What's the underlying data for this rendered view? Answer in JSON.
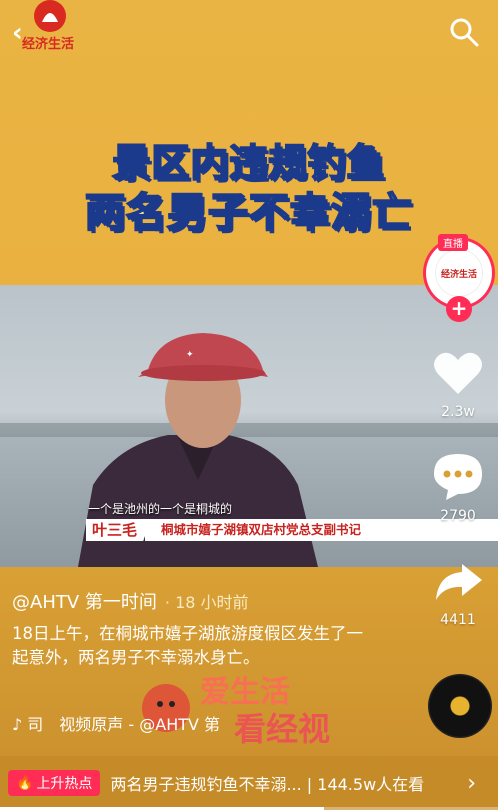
{
  "brand": {
    "logo_text": "经济生活"
  },
  "headline": {
    "line1": "景区内违规钓鱼",
    "line2": "两名男子不幸溺亡"
  },
  "video": {
    "subtitle": "一个是池州的一个是桐城的",
    "speaker_name": "叶三毛",
    "speaker_title": "桐城市嬉子湖镇双店村党总支副书记"
  },
  "sidebar": {
    "live_tag": "直播",
    "avatar_text": "经济生活",
    "follow": "+",
    "likes": "2.3w",
    "comments": "2790",
    "shares": "4411"
  },
  "post": {
    "author": "@AHTV 第一时间",
    "time": "· 18 小时前",
    "description": "18日上午，在桐城市嬉子湖旅游度假区发生了一起意外，两名男子不幸溺水身亡。",
    "music": "♪ 司　视频原声 - @AHTV 第"
  },
  "watermark": {
    "line1": "爱生活",
    "line2": "看经视"
  },
  "hot": {
    "badge": "上升热点",
    "text": "两名男子违规钓鱼不幸溺... | 144.5w人在看"
  },
  "colors": {
    "accent": "#ff2d55",
    "headline_fill": "#fff59a",
    "headline_stroke": "#1b3a8c"
  },
  "progress_fraction": 0.65
}
